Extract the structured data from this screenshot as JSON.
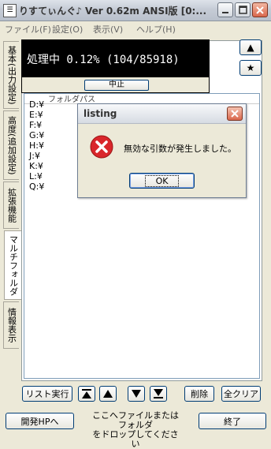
{
  "window": {
    "title": "りすてぃんぐ♪ Ver 0.62m ANSI版 [0:...",
    "app_icon_glyph": "☰"
  },
  "menu": [
    {
      "label": "ファイル(F)"
    },
    {
      "label": "設定(O)"
    },
    {
      "label": "表示(V)"
    },
    {
      "label": "ヘルプ(H)"
    }
  ],
  "side_tabs": [
    {
      "label": "基本(出力設定)"
    },
    {
      "label": "高度(追加設定)"
    },
    {
      "label": "拡張機能"
    },
    {
      "label": "マルチフォルダ"
    },
    {
      "label": "情報表示"
    }
  ],
  "side_buttons": {
    "up_label": "▲",
    "star_label": "★"
  },
  "progress": {
    "text": "処理中 0.12% (104/85918)",
    "done": 104,
    "total": 85918,
    "stop_label": "中止"
  },
  "list": {
    "header": "フォルダパス",
    "items": [
      "D:¥",
      "E:¥",
      "F:¥",
      "G:¥",
      "H:¥",
      "J:¥",
      "K:¥",
      "L:¥",
      "Q:¥"
    ]
  },
  "dialog": {
    "title": "listing",
    "message": "無効な引数が発生しました。",
    "ok_label": "OK"
  },
  "toolbar": {
    "run_label": "リスト実行",
    "delete_label": "削除",
    "clear_label": "全クリア"
  },
  "footer": {
    "dev_label": "開発HPへ",
    "drop_line1": "ここへファイルまたはフォルダ",
    "drop_line2": "をドロップしてください",
    "exit_label": "終了"
  },
  "colors": {
    "window_bg": "#ece9d8",
    "progress_bg": "#000000",
    "progress_text": "#ffffff",
    "error_red": "#d9262b",
    "button_border": "#003c74"
  }
}
